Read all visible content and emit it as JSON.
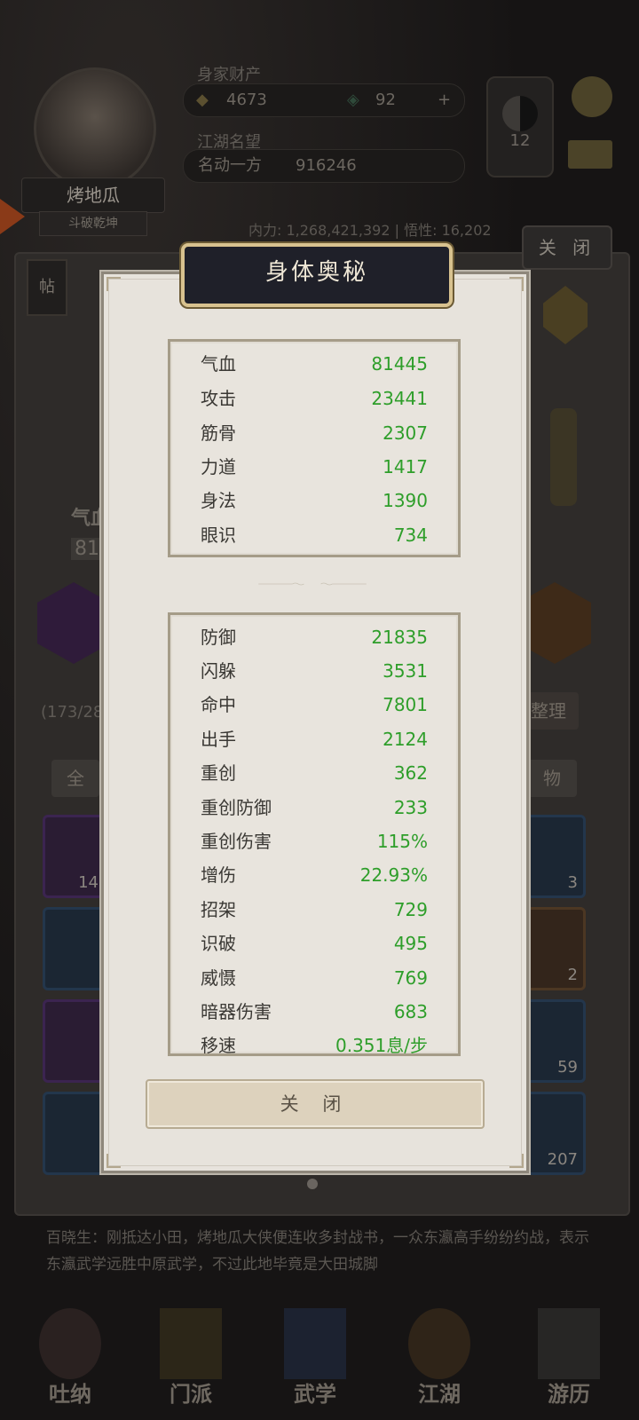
{
  "background": {
    "player_name": "烤地瓜",
    "player_subtitle": "斗破乾坤",
    "wealth_label": "身家财产",
    "gold": "4673",
    "jade": "92",
    "reputation_label": "江湖名望",
    "reputation_title": "名动一方",
    "reputation_value": "916246",
    "medallion_level": "12",
    "stats_line": "内力: 1,268,421,392  | 悟性: 16,202",
    "close_label": "关 闭",
    "tie_label": "帖",
    "left_stat_fragment": "气血",
    "left_value_fragment": "81",
    "capacity": "(173/28",
    "arrange_label": "整理",
    "filter_all": "全",
    "filter_item": "物",
    "slot_counts": [
      "14",
      "3",
      "2",
      "59",
      "207"
    ],
    "story_text": "百晓生：刚抵达小田，烤地瓜大侠便连收多封战书，一众东瀛高手纷纷约战，表示东瀛武学远胜中原武学，不过此地毕竟是大田城脚",
    "nav": [
      "吐纳",
      "门派",
      "武学",
      "江湖",
      "游历"
    ]
  },
  "modal": {
    "title": "身体奥秘",
    "primary_stats": [
      {
        "label": "气血",
        "value": "81445"
      },
      {
        "label": "攻击",
        "value": "23441"
      },
      {
        "label": "筋骨",
        "value": "2307"
      },
      {
        "label": "力道",
        "value": "1417"
      },
      {
        "label": "身法",
        "value": "1390"
      },
      {
        "label": "眼识",
        "value": "734"
      }
    ],
    "secondary_stats": [
      {
        "label": "防御",
        "value": "21835"
      },
      {
        "label": "闪躲",
        "value": "3531"
      },
      {
        "label": "命中",
        "value": "7801"
      },
      {
        "label": "出手",
        "value": "2124"
      },
      {
        "label": "重创",
        "value": "362"
      },
      {
        "label": "重创防御",
        "value": "233"
      },
      {
        "label": "重创伤害",
        "value": "115%"
      },
      {
        "label": "增伤",
        "value": "22.93%"
      },
      {
        "label": "招架",
        "value": "729"
      },
      {
        "label": "识破",
        "value": "495"
      },
      {
        "label": "威慑",
        "value": "769"
      },
      {
        "label": "暗器伤害",
        "value": "683"
      },
      {
        "label": "移速",
        "value": "0.351息/步"
      }
    ],
    "close_label": "关 闭"
  },
  "colors": {
    "stat_value": "#2e9e2a",
    "title_bg": "#1f2029",
    "title_border": "#d8c28f"
  }
}
